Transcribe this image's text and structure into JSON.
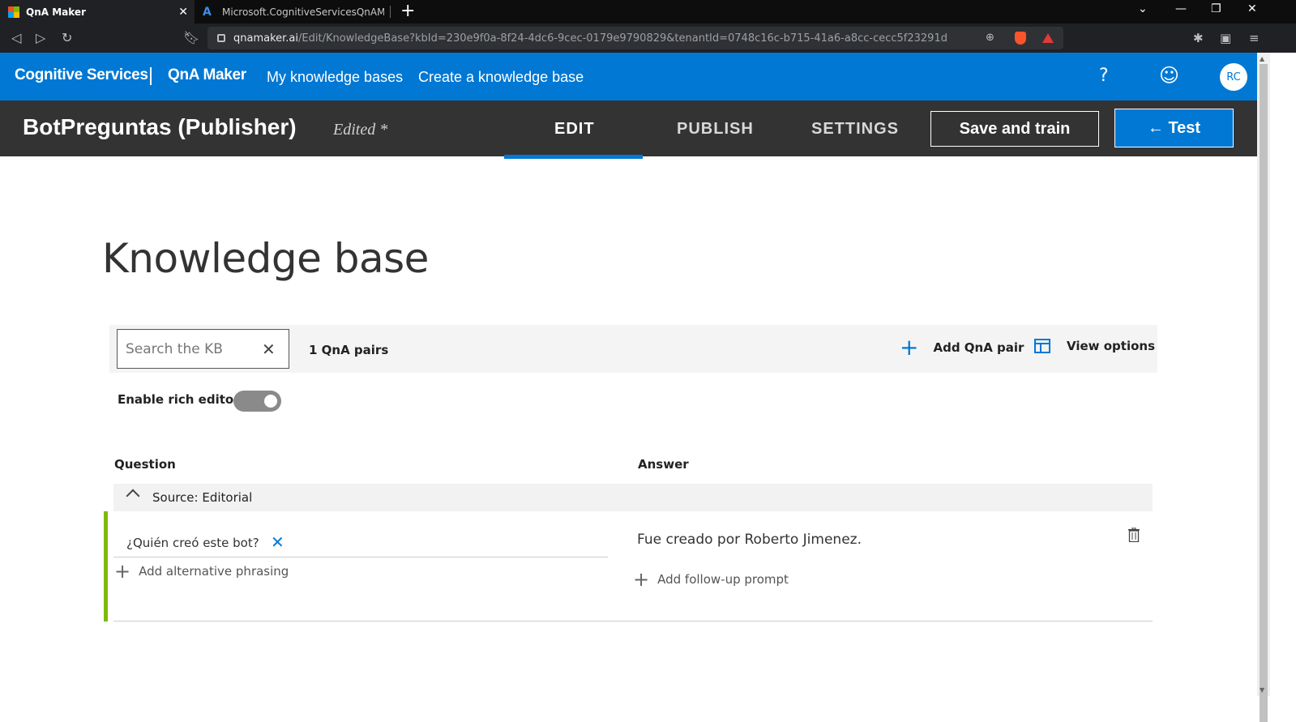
{
  "browser": {
    "tabs": [
      {
        "title": "QnA Maker"
      },
      {
        "title": "Microsoft.CognitiveServicesQnAMaker"
      }
    ],
    "url_host": "qnamaker.ai",
    "url_path": "/Edit/KnowledgeBase?kbId=230e9f0a-8f24-4dc6-9cec-0179e9790829&tenantId=0748c16c-b715-41a6-a8cc-cecc5f23291d"
  },
  "appbar": {
    "brand": "Cognitive Services",
    "product": "QnA Maker",
    "nav": [
      "My knowledge bases",
      "Create a knowledge base"
    ],
    "help": "?",
    "avatar_initials": "RC"
  },
  "kb": {
    "title": "BotPreguntas (Publisher)",
    "status": "Edited *",
    "tabs": [
      "EDIT",
      "PUBLISH",
      "SETTINGS"
    ],
    "active_tab": "EDIT",
    "save_label": "Save and train",
    "test_label": "← Test"
  },
  "page": {
    "title": "Knowledge base",
    "search_placeholder": "Search the KB",
    "pair_count": "1 QnA pairs",
    "add_pair_label": "Add QnA pair",
    "view_options_label": "View options",
    "rich_editor_label": "Enable rich editor",
    "rich_editor_on": true,
    "columns": {
      "question": "Question",
      "answer": "Answer"
    },
    "source_label": "Source: Editorial",
    "pairs": [
      {
        "question": "¿Quién creó este bot?",
        "add_alt_label": "Add alternative phrasing",
        "answer": "Fue creado por Roberto Jimenez.",
        "add_followup_label": "Add follow-up prompt"
      }
    ]
  },
  "colors": {
    "accent": "#0078d4",
    "header_dark": "#333333",
    "row_accent": "#7fba00"
  }
}
